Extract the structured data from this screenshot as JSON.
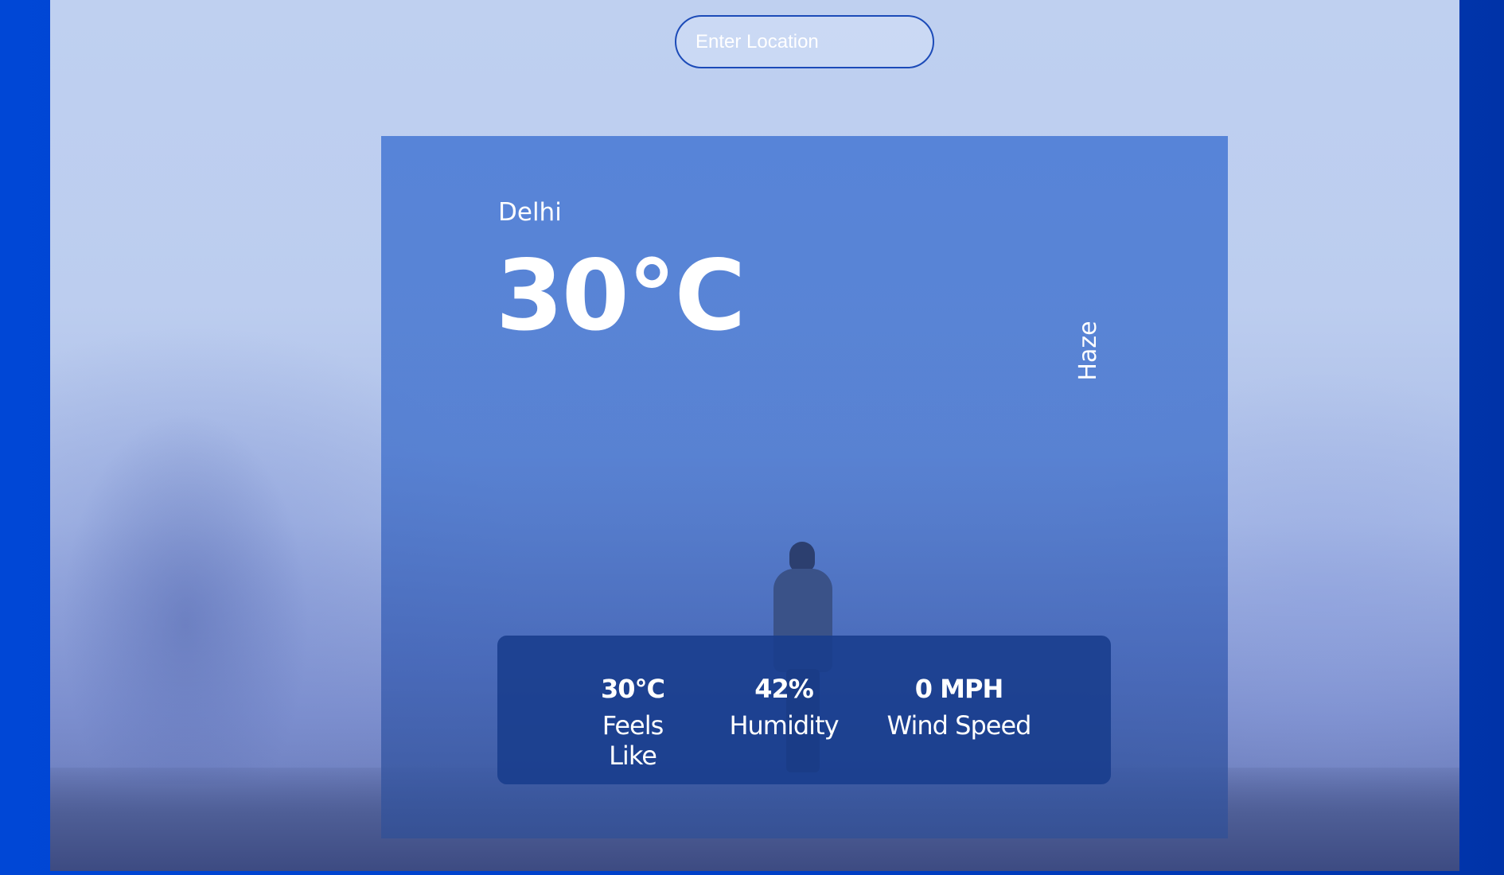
{
  "search": {
    "placeholder": "Enter Location",
    "value": ""
  },
  "weather": {
    "city": "Delhi",
    "temperature": "30°C",
    "condition": "Haze"
  },
  "stats": [
    {
      "value": "30°C",
      "label": "Feels Like"
    },
    {
      "value": "42%",
      "label": "Humidity"
    },
    {
      "value": "0 MPH",
      "label": "Wind Speed"
    }
  ],
  "colors": {
    "outer_background": "#0047d6",
    "card": "#4678d4",
    "stats_panel": "#183c8c",
    "text": "#ffffff",
    "search_border": "#1c4bb8"
  },
  "background_image": "foggy-landscape-with-hiker"
}
